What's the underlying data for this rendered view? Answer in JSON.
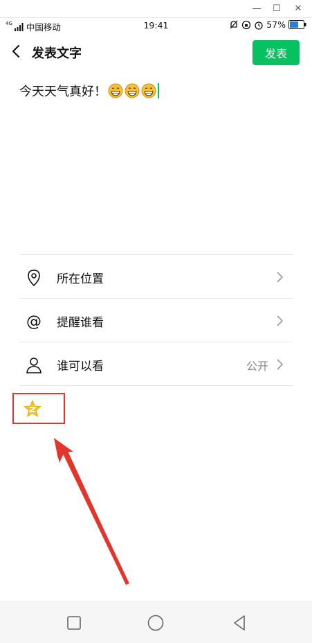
{
  "status": {
    "network_badge": "4G",
    "carrier": "中国移动",
    "time": "19:41",
    "battery_percent": "57%"
  },
  "header": {
    "title": "发表文字",
    "post_label": "发表"
  },
  "editor": {
    "text": "今天天气真好！",
    "emoji_count": 3
  },
  "options": [
    {
      "label": "所在位置",
      "value": "",
      "icon": "location-pin-icon"
    },
    {
      "label": "提醒谁看",
      "value": "",
      "icon": "at-sign-icon"
    },
    {
      "label": "谁可以看",
      "value": "公开",
      "icon": "person-icon"
    }
  ],
  "extras": {
    "qzone_icon": "qzone-star-icon",
    "annotation_color": "#e2352b"
  },
  "colors": {
    "accent": "#07c160"
  }
}
